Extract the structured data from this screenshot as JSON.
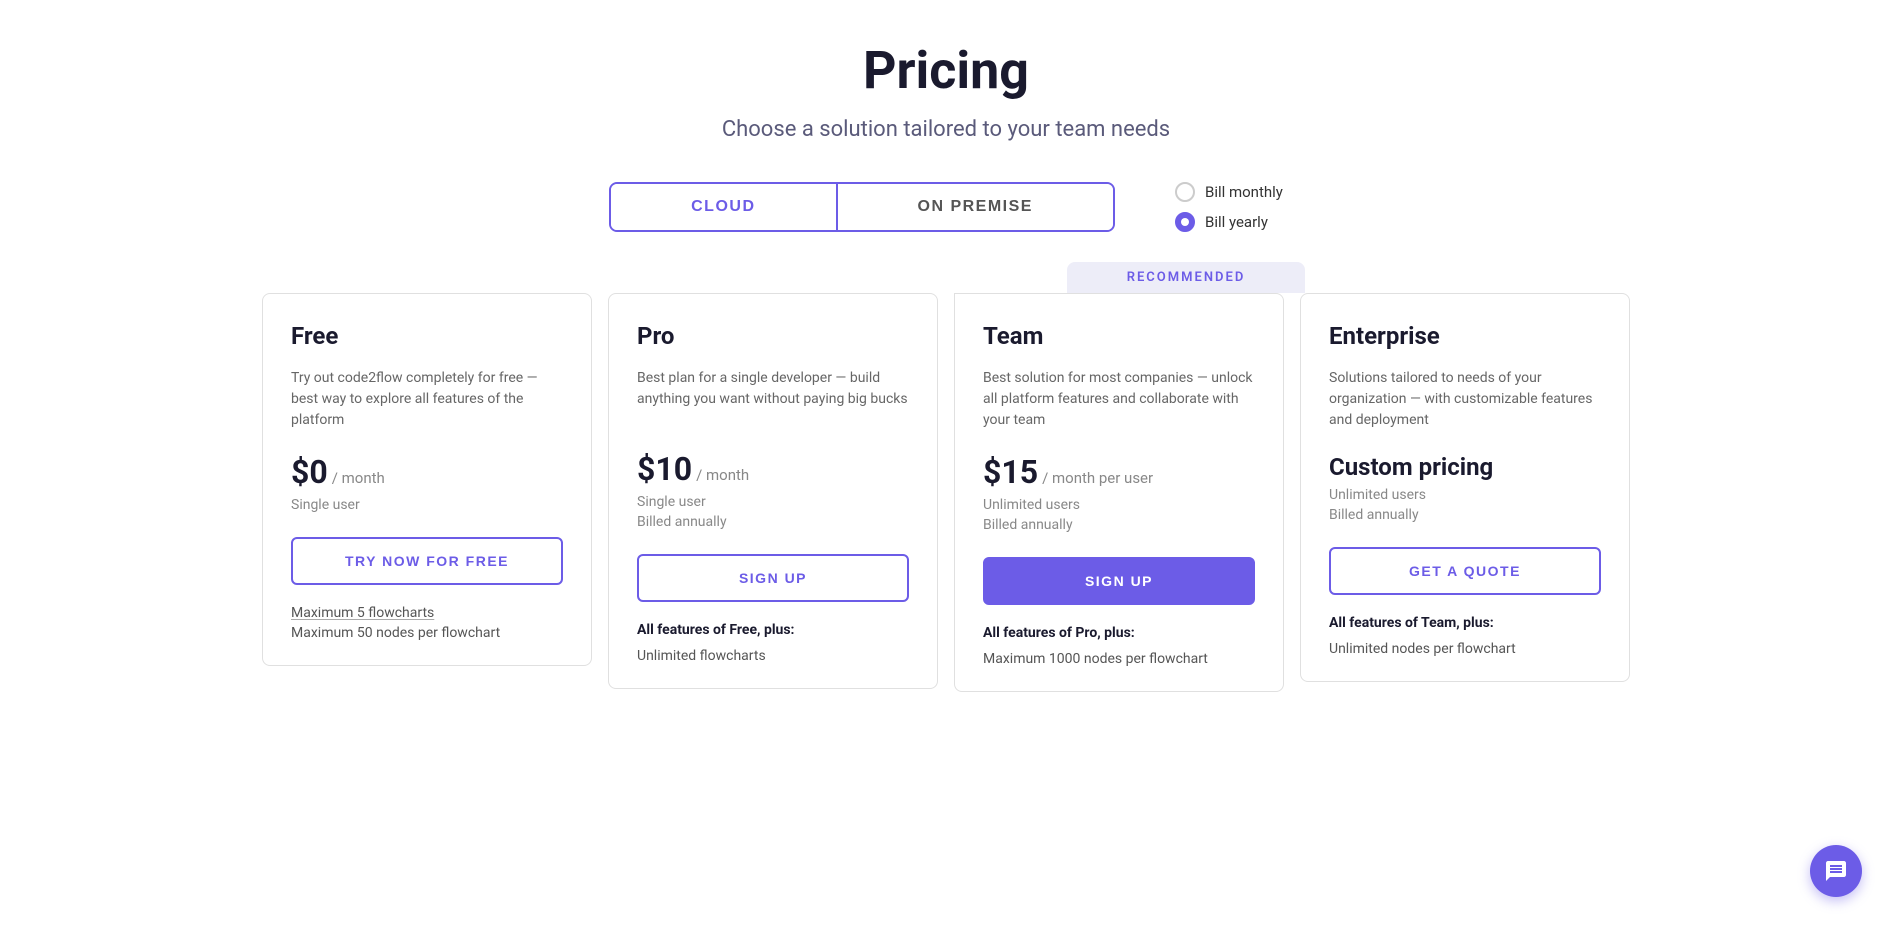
{
  "page": {
    "title": "Pricing",
    "subtitle": "Choose a solution tailored to your team needs"
  },
  "tabs": {
    "cloud_label": "CLOUD",
    "on_premise_label": "ON PREMISE",
    "active": "cloud"
  },
  "billing": {
    "monthly_label": "Bill monthly",
    "yearly_label": "Bill yearly",
    "selected": "yearly"
  },
  "recommended_banner": "RECOMMENDED",
  "plans": [
    {
      "id": "free",
      "name": "Free",
      "description": "Try out code2flow completely for free — best way to explore all features of the platform",
      "price": "$0",
      "price_period": "/ month",
      "user_info": "Single user",
      "billing_info": "",
      "cta_label": "TRY NOW FOR FREE",
      "cta_style": "outline",
      "features_title": "",
      "features": [
        "Maximum 5 flowcharts",
        "Maximum 50 nodes per flowchart"
      ]
    },
    {
      "id": "pro",
      "name": "Pro",
      "description": "Best plan for a single developer — build anything you want without paying big bucks",
      "price": "$10",
      "price_period": "/ month",
      "user_info": "Single user",
      "billing_info": "Billed annually",
      "cta_label": "SIGN UP",
      "cta_style": "outline",
      "features_title": "All features of Free, plus:",
      "features": [
        "Unlimited flowcharts"
      ]
    },
    {
      "id": "team",
      "name": "Team",
      "description": "Best solution for most companies — unlock all platform features and collaborate with your team",
      "price": "$15",
      "price_period": "/ month per user",
      "user_info": "Unlimited users",
      "billing_info": "Billed annually",
      "cta_label": "SIGN UP",
      "cta_style": "solid",
      "features_title": "All features of Pro, plus:",
      "features": [
        "Maximum 1000 nodes per flowchart"
      ],
      "recommended": true
    },
    {
      "id": "enterprise",
      "name": "Enterprise",
      "description": "Solutions tailored to needs of your organization — with customizable features and deployment",
      "price_custom": "Custom pricing",
      "user_info": "Unlimited users",
      "billing_info": "Billed annually",
      "cta_label": "GET A QUOTE",
      "cta_style": "outline",
      "features_title": "All features of Team, plus:",
      "features": [
        "Unlimited nodes per flowchart"
      ]
    }
  ]
}
